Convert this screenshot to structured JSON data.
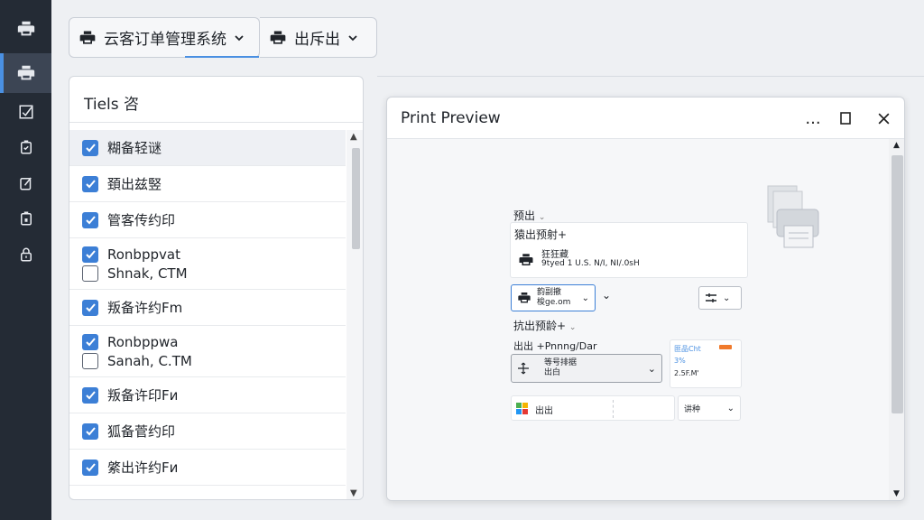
{
  "toolbar": {
    "system_label": "云客订单管理系统",
    "second_label": "出斥出"
  },
  "rail": {
    "items": [
      "printer-icon",
      "printer-icon",
      "checkbox-icon",
      "clipboard-icon",
      "edit-icon",
      "clipboard-lock-icon",
      "lock-icon"
    ]
  },
  "panel": {
    "title": "Tiels 咨",
    "rows": [
      {
        "lines": [
          {
            "checked": true,
            "text": "糊备轻谜"
          }
        ]
      },
      {
        "lines": [
          {
            "checked": true,
            "text": "頚出兹竪"
          }
        ]
      },
      {
        "lines": [
          {
            "checked": true,
            "text": "管客传约印"
          }
        ]
      },
      {
        "lines": [
          {
            "checked": true,
            "text": "Ronbppvat"
          },
          {
            "checked": false,
            "text": "Shnak, CTM"
          }
        ]
      },
      {
        "lines": [
          {
            "checked": true,
            "text": "叛备许约Fm"
          }
        ]
      },
      {
        "lines": [
          {
            "checked": true,
            "text": "Ronbppwa"
          },
          {
            "checked": false,
            "text": "Sanah, C.TM"
          }
        ]
      },
      {
        "lines": [
          {
            "checked": true,
            "text": "叛备许印Fи"
          }
        ]
      },
      {
        "lines": [
          {
            "checked": true,
            "text": "狐备菅约印"
          }
        ]
      },
      {
        "lines": [
          {
            "checked": true,
            "text": "綮出许约Fи"
          }
        ]
      }
    ]
  },
  "preview": {
    "title": "Print Preview",
    "more_label": "...",
    "section1_label": "预出",
    "printer_card_title": "猿出预射+",
    "printer_name": "狂狂藏",
    "printer_detail": "9tyed 1 U.S. N/I, NI/.0sH",
    "select1_line1": "韵副撤",
    "select1_line2": "梭ge.om",
    "section2_label": "抗出预龄+",
    "setting_label": "出出 +Pnnng/Dar",
    "setting_select_line1": "等号排据",
    "setting_select_line2": "出白",
    "side_line1": "匪品Cht",
    "side_line2": "3%",
    "side_line3": "2.5F.M'",
    "bottom_label": "出出",
    "bottom_select": "讲种",
    "colors": {
      "accent": "#4a90e2",
      "checkbox": "#3c7fd6",
      "rail": "#242b35",
      "orange": "#f07a2c"
    }
  }
}
